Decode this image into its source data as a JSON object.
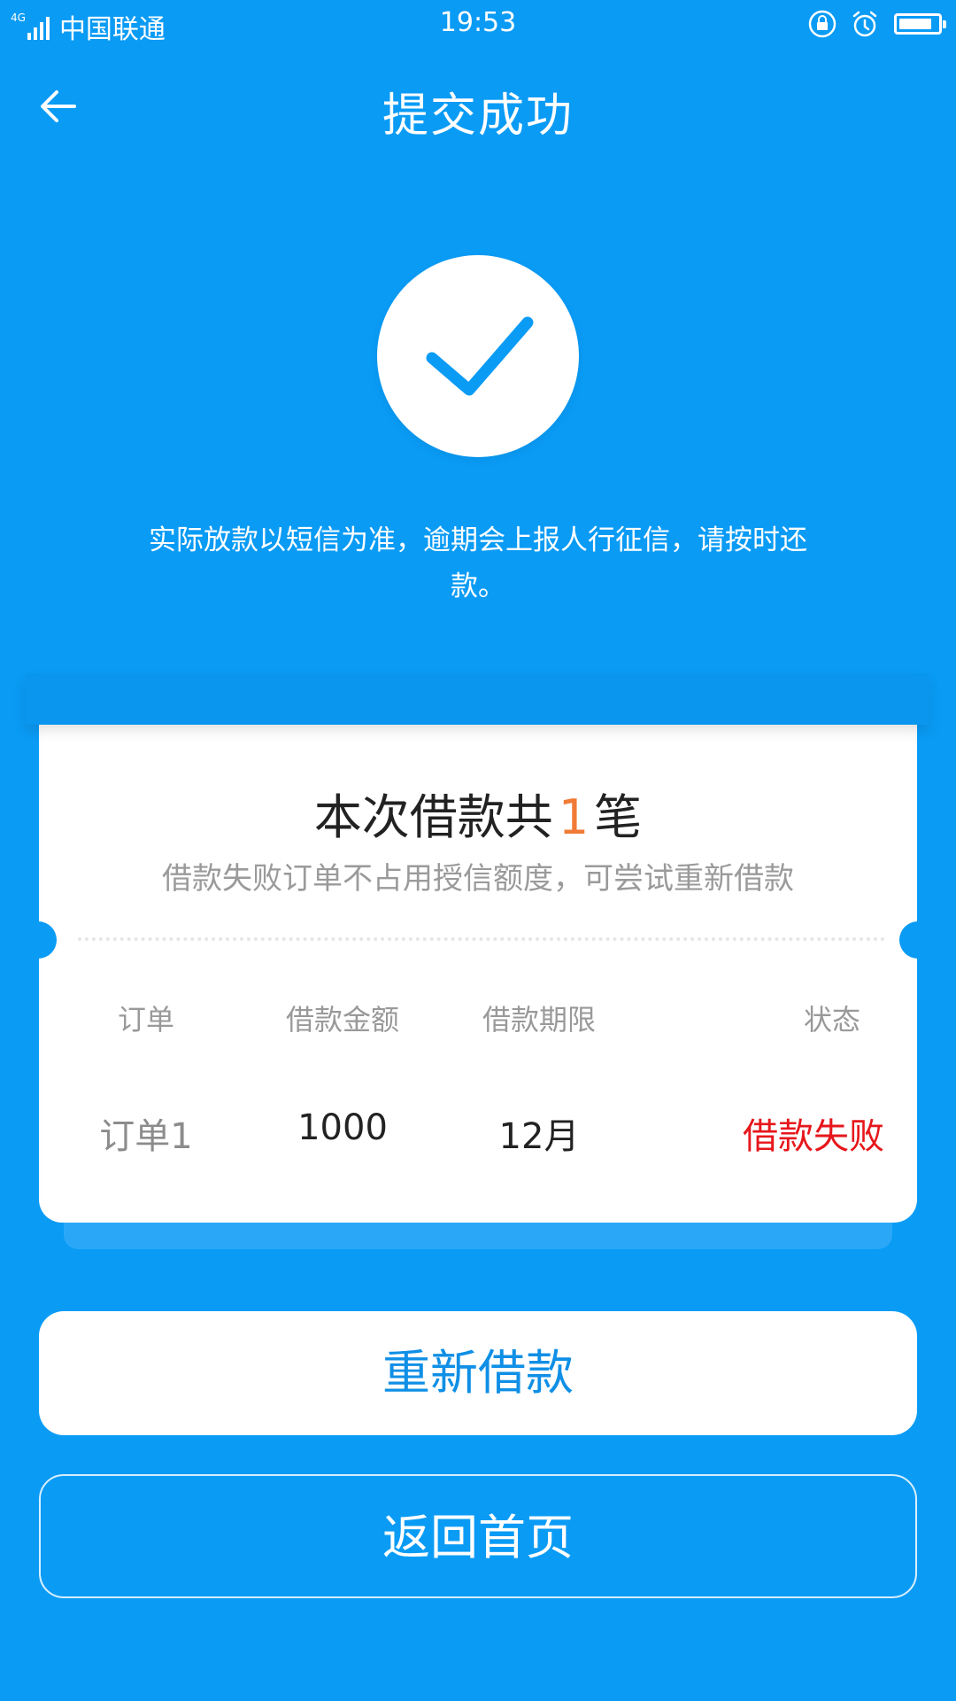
{
  "status_bar": {
    "network": "4G",
    "carrier": "中国联通",
    "time": "19:53",
    "battery_level": 0.88
  },
  "header": {
    "title": "提交成功"
  },
  "notice": "实际放款以短信为准，逾期会上报人行征信，请按时还款。",
  "summary": {
    "prefix": "本次借款共",
    "count": "1",
    "suffix": "笔",
    "subtitle": "借款失败订单不占用授信额度，可尝试重新借款"
  },
  "table": {
    "headers": [
      "订单",
      "借款金额",
      "借款期限",
      "状态"
    ],
    "rows": [
      [
        "订单1",
        "1000",
        "12月",
        "借款失败"
      ]
    ]
  },
  "buttons": {
    "retry": "重新借款",
    "home": "返回首页"
  },
  "colors": {
    "background": "#0a9bf5",
    "count_highlight": "#f07a36",
    "status_failed": "#e6171c",
    "retry_text": "#0f8fe6"
  },
  "icons": [
    "back-arrow-icon",
    "check-icon",
    "lock-rotation-icon",
    "alarm-icon",
    "battery-icon",
    "signal-icon"
  ]
}
